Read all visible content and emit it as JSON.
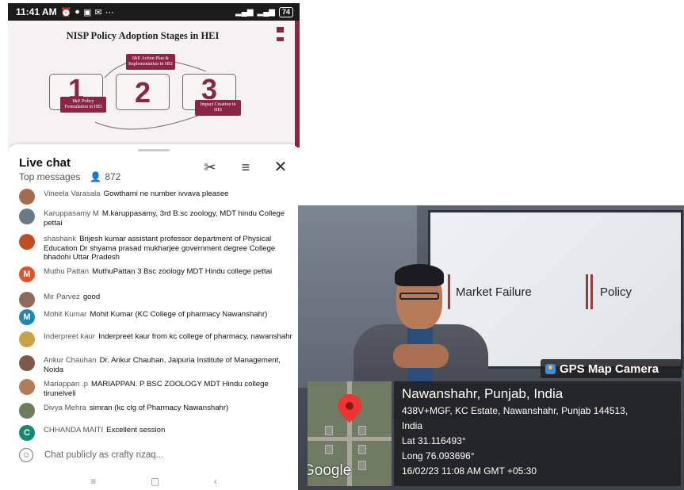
{
  "status_bar": {
    "time": "11:41 AM",
    "battery": "74"
  },
  "slide": {
    "title": "NISP Policy Adoption Stages in HEI",
    "stages": [
      {
        "number": "1",
        "label": "I&E Policy Formulation in HEI"
      },
      {
        "number": "2",
        "label": "I&E Action Plan & Implementation in HEI"
      },
      {
        "number": "3",
        "label": "Impact Creation in HEI"
      }
    ],
    "accent_color": "#8a2547"
  },
  "chat": {
    "title": "Live chat",
    "filter": "Top messages",
    "viewer_count": "872",
    "messages": [
      {
        "author": "Vineela Varasala",
        "text": "Gowthami ne number ivvava pleasee",
        "avatar": "photo",
        "color": "#a36b4f"
      },
      {
        "author": "Karuppasamy M",
        "text": "M.karuppasamy, 3rd B.sc zoology, MDT hindu College pettai",
        "avatar": "photo",
        "color": "#6b7a85"
      },
      {
        "author": "shashank",
        "text": "Brijesh kumar assistant professor department of Physical Education Dr shyama prasad mukharjee government degree College bhadohi Uttar Pradesh",
        "avatar": "photo",
        "color": "#c24d1f"
      },
      {
        "author": "Muthu Pattan",
        "text": "MuthuPattan 3 Bsc zoology MDT Hindu college pettai",
        "avatar": "M",
        "color": "#e0522a"
      },
      {
        "author": "Mir Parvez",
        "text": "good",
        "avatar": "photo",
        "color": "#8d6a57"
      },
      {
        "author": "Mohit Kumar",
        "text": "Mohit Kumar (KC College of pharmacy Nawanshahr)",
        "avatar": "M",
        "color": "#1e88b5"
      },
      {
        "author": "Inderpreet kaur",
        "text": "Inderpreet kaur from kc college of pharmacy, nawanshahr",
        "avatar": "photo",
        "color": "#c9a34a"
      },
      {
        "author": "Ankur Chauhan",
        "text": "Dr. Ankur Chauhan, Jaipuria Institute of Management, Noida",
        "avatar": "photo",
        "color": "#7d5a48"
      },
      {
        "author": "Mariappan .p",
        "text": "MARIAPPAN. P BSC ZOOLOGY MDT Hindu college tirunelveli",
        "avatar": "photo",
        "color": "#b07c55"
      },
      {
        "author": "Divya Mehra",
        "text": "simran (kc clg of Pharmacy Nawanshahr)",
        "avatar": "photo",
        "color": "#6c7d57"
      },
      {
        "author": "CHHANDA MAITI",
        "text": "Excellent session",
        "avatar": "C",
        "color": "#148a6e"
      }
    ],
    "input_placeholder": "Chat publicly as crafty rizaq..."
  },
  "photo": {
    "screen_left": "Market Failure",
    "screen_right": "Policy",
    "badge": "GPS Map Camera",
    "map_brand": "Google",
    "place": "Nawanshahr, Punjab, India",
    "address": "438V+MGF, KC Estate, Nawanshahr, Punjab 144513,",
    "country": "India",
    "lat": "Lat 31.116493°",
    "long": "Long 76.093696°",
    "datetime": "16/02/23 11:08 AM GMT +05:30"
  }
}
